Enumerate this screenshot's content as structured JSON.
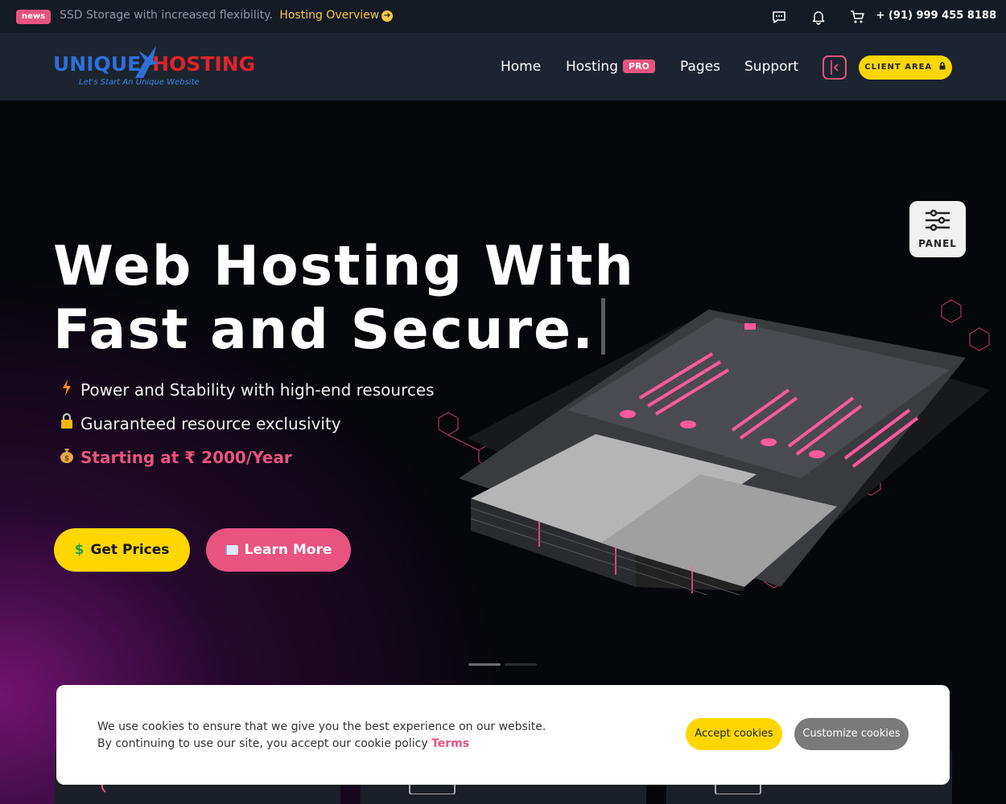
{
  "topbar": {
    "badge": "news",
    "message": "SSD Storage with increased flexibility.",
    "link": "Hosting Overview",
    "phone": "+ (91) 999 455 8188",
    "icons": [
      "chat-icon",
      "bell-icon",
      "cart-icon"
    ]
  },
  "header": {
    "logo": {
      "left_text": "UNIQUE",
      "right_text": "HOSTING",
      "tagline": "Let's Start An Unique Website"
    },
    "nav": [
      {
        "label": "Home"
      },
      {
        "label": "Hosting",
        "badge": "PRO"
      },
      {
        "label": "Pages"
      },
      {
        "label": "Support"
      }
    ],
    "client_area": "CLIENT AREA"
  },
  "hero": {
    "title_line1": "Web Hosting With",
    "title_line2": "Fast and Secure.",
    "features": [
      {
        "icon": "lightning-icon",
        "text": "Power and Stability with high-end resources"
      },
      {
        "icon": "lock-icon",
        "text": "Guaranteed resource exclusivity"
      },
      {
        "icon": "money-bag-icon",
        "text": "Starting at ₹ 2000/Year"
      }
    ],
    "btn_prices": "Get Prices",
    "btn_learn": "Learn More",
    "panel": "PANEL"
  },
  "cookie": {
    "line1": "We use cookies to ensure that we give you the best experience on our website.",
    "line2": "By continuing to use our site, you accept our cookie policy",
    "terms": "Terms",
    "accept": "Accept cookies",
    "customize": "Customize cookies"
  },
  "colors": {
    "accent_yellow": "#ffd600",
    "accent_pink": "#e8547f",
    "topbar_bg": "#141b24",
    "header_bg": "#1c242f"
  }
}
